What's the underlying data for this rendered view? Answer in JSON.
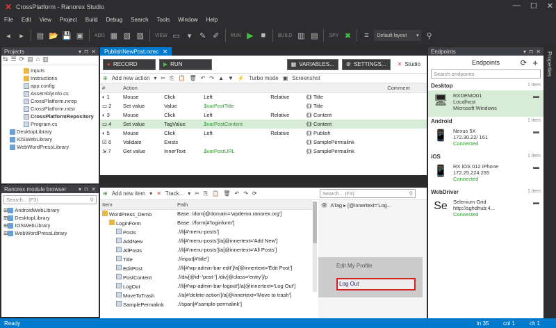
{
  "window": {
    "title": "CrossPlatform - Ranorex Studio"
  },
  "menu": [
    "File",
    "Edit",
    "View",
    "Project",
    "Build",
    "Debug",
    "Search",
    "Tools",
    "Window",
    "Help"
  ],
  "toolbar": {
    "add": "ADD",
    "view": "VIEW",
    "run": "RUN",
    "build": "BUILD",
    "spy": "SPY",
    "layout": "Default layout"
  },
  "projects": {
    "title": "Projects",
    "tree": [
      {
        "label": "Inputs",
        "indent": 3,
        "type": "fold"
      },
      {
        "label": "Instructions",
        "indent": 3,
        "type": "fold"
      },
      {
        "label": "app.config",
        "indent": 3,
        "type": "file"
      },
      {
        "label": "AssemblyInfo.cs",
        "indent": 3,
        "type": "file"
      },
      {
        "label": "CrossPlatform.rxrep",
        "indent": 3,
        "type": "file"
      },
      {
        "label": "CrossPlatform.rxtst",
        "indent": 3,
        "type": "file"
      },
      {
        "label": "CrossPlatformRepository",
        "indent": 3,
        "type": "file",
        "bold": true
      },
      {
        "label": "Program.cs",
        "indent": 3,
        "type": "file"
      },
      {
        "label": "DesktopLibrary",
        "indent": 1,
        "type": "repo"
      },
      {
        "label": "IOSWebLibrary",
        "indent": 1,
        "type": "repo"
      },
      {
        "label": "WebWordPressLibrary",
        "indent": 1,
        "type": "repo"
      }
    ]
  },
  "module_browser": {
    "title": "Ranorex module browser",
    "search": "Search... (F3)",
    "items": [
      "AndroidWebLibrary",
      "DesktopLibrary",
      "IOSWebLibrary",
      "WebWordPressLibrary"
    ]
  },
  "editor": {
    "tab": "PublishNewPost.rxrec",
    "record": "RECORD",
    "run": "RUN",
    "variables": "VARIABLES...",
    "settings": "SETTINGS...",
    "studio": "Studio",
    "add_action": "Add new action",
    "turbo": "Turbo mode",
    "screenshot": "Screenshot",
    "columns": [
      "#",
      "Action",
      "",
      "",
      "",
      "",
      "Comment"
    ],
    "actions": [
      {
        "n": "1",
        "action": "Mouse",
        "a": "Click",
        "b": "Left",
        "c": "Relative",
        "item": "Title"
      },
      {
        "n": "2",
        "action": "Set value",
        "a": "Value",
        "b": "$varPostTitle",
        "c": "",
        "item": "Title"
      },
      {
        "n": "3",
        "action": "Mouse",
        "a": "Click",
        "b": "Left",
        "c": "Relative",
        "item": "Content"
      },
      {
        "n": "4",
        "action": "Set value",
        "a": "TagValue",
        "b": "$varPostContent",
        "c": "",
        "item": "Content"
      },
      {
        "n": "5",
        "action": "Mouse",
        "a": "Click",
        "b": "Left",
        "c": "Relative",
        "item": "Publish"
      },
      {
        "n": "6",
        "action": "Validate",
        "a": "Exists",
        "b": "",
        "c": "",
        "item": "SamplePermalink"
      },
      {
        "n": "7",
        "action": "Get value",
        "a": "InnerText",
        "b": "$varPostURL",
        "c": "",
        "item": "SamplePermalink"
      }
    ]
  },
  "repository": {
    "add_item": "Add new item",
    "track": "Track...",
    "search": "Search... (F3)",
    "columns": [
      "Item",
      "Path"
    ],
    "items": [
      {
        "label": "WordPress_Demo",
        "path": "Base: /dom[@domain='wpdemo.ranorex.org']",
        "indent": 0
      },
      {
        "label": "LoginForm",
        "path": "Base: //form[#'loginform']",
        "indent": 1
      },
      {
        "label": "Posts",
        "path": ".//li[#'menu-posts']",
        "indent": 2
      },
      {
        "label": "AddNew",
        "path": ".//li[#'menu-posts']/a[@innertext='Add New']",
        "indent": 2
      },
      {
        "label": "AllPosts",
        "path": ".//li[#'menu-posts']/a[@innertext='All Posts']",
        "indent": 2
      },
      {
        "label": "Title",
        "path": ".//input[#'title']",
        "indent": 2
      },
      {
        "label": "EditPost",
        "path": ".//li[#'wp-admin-bar-edit']/a[@innertext='Edit Post']",
        "indent": 2
      },
      {
        "label": "PostContent",
        "path": ".//div[@id~'post-'] /div[@class='entry']/p",
        "indent": 2
      },
      {
        "label": "LogOut",
        "path": ".//li[#'wp-admin-bar-logout']/a[@innertext='Log Out']",
        "indent": 2
      },
      {
        "label": "MoveToTrash",
        "path": ".//a[#'delete-action']/a[@innertext='Move to trash']",
        "indent": 2
      },
      {
        "label": "SamplePermalink",
        "path": ".//span[#'sample-permalink']",
        "indent": 2
      }
    ],
    "preview_path": "ATag  ▸ [@innertext='Log...",
    "preview_menu": [
      "Edit My Profile",
      "Log Out"
    ]
  },
  "endpoints": {
    "title": "Endpoints",
    "header": "Endpoints",
    "search": "Search endpoints",
    "groups": [
      {
        "name": "Desktop",
        "count": "1 item",
        "items": [
          {
            "name": "RXDEMO01",
            "l2": "Localhost",
            "l3": "Microsoft Windows",
            "icon": "desktop-icon",
            "sel": true
          }
        ]
      },
      {
        "name": "Android",
        "count": "1 item",
        "items": [
          {
            "name": "Nexus 5X",
            "l2": "172.30.22/ 161",
            "l3": "Connected",
            "icon": "android-icon"
          }
        ]
      },
      {
        "name": "iOS",
        "count": "1 item",
        "items": [
          {
            "name": "RX iOS 012 iPhone",
            "l2": "172.25.224.255",
            "l3": "Connected",
            "icon": "iphone-icon"
          }
        ]
      },
      {
        "name": "WebDriver",
        "count": "1 item",
        "items": [
          {
            "name": "Selenium Grid",
            "l2": "http://sghdhub:4...",
            "l3": "Connected",
            "icon": "selenium-icon"
          }
        ]
      }
    ]
  },
  "properties_tab": "Properties",
  "status": {
    "left": "Ready",
    "ln": "ln 35",
    "col": "col 1",
    "ch": "ch 1"
  }
}
